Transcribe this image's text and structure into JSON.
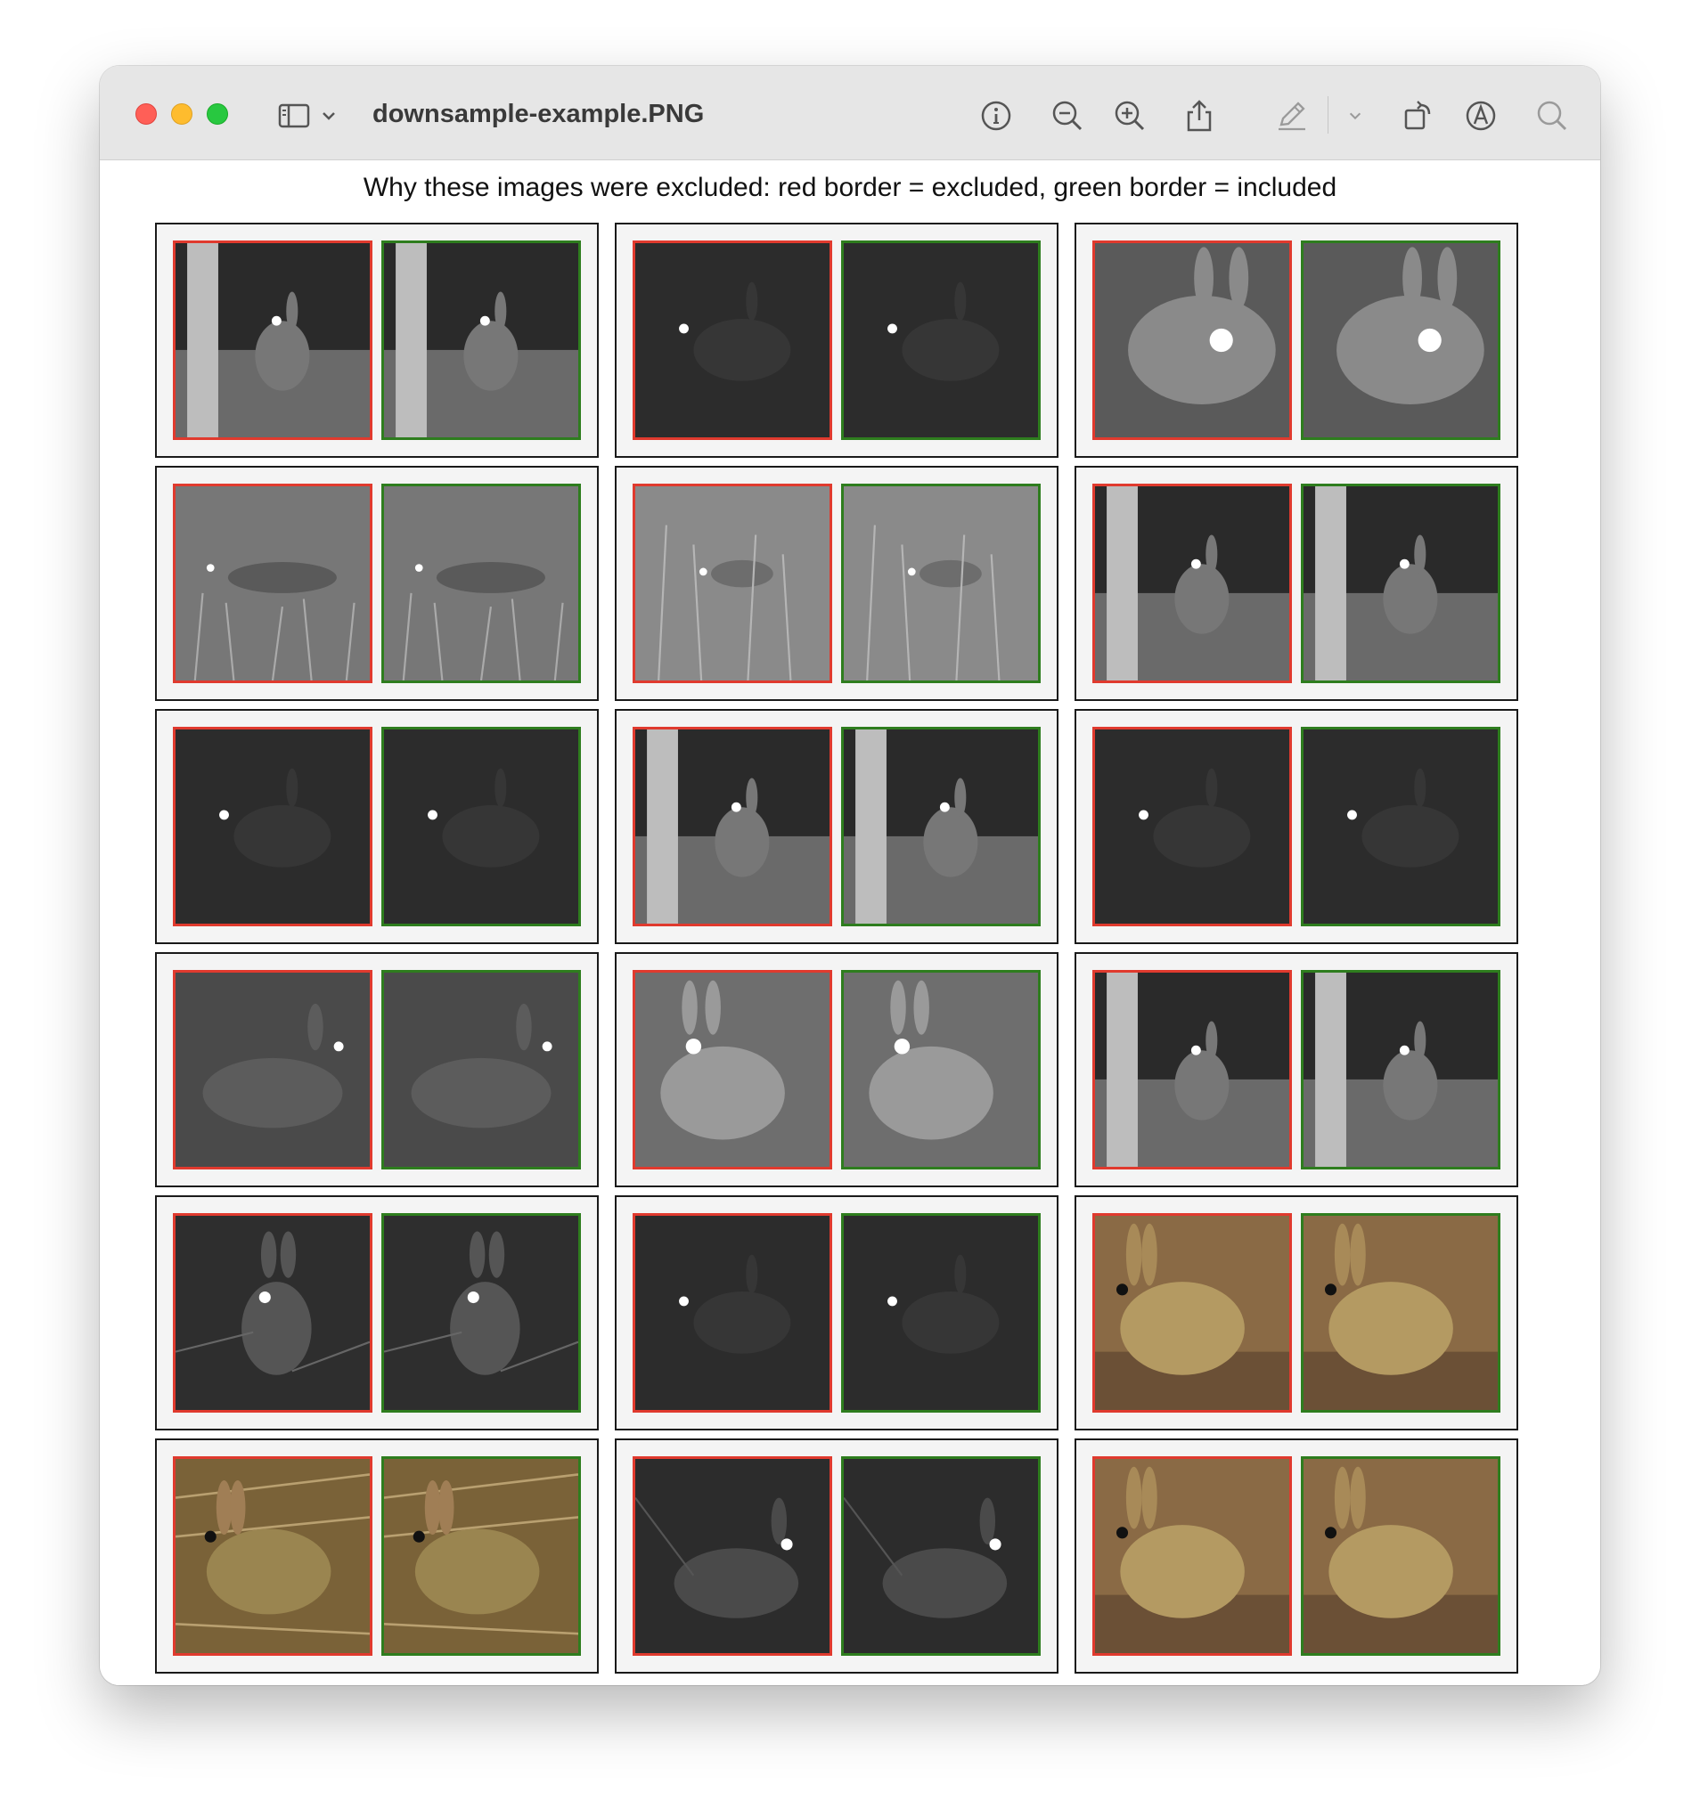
{
  "window": {
    "title": "downsample-example.PNG",
    "toolbar": [
      {
        "name": "sidebar-toggle",
        "icon": "sidebar-icon"
      },
      {
        "name": "sidebar-menu",
        "icon": "chevron-down-icon"
      },
      {
        "name": "info",
        "icon": "info-icon"
      },
      {
        "name": "zoom-out",
        "icon": "zoom-out-icon"
      },
      {
        "name": "zoom-in",
        "icon": "zoom-in-icon"
      },
      {
        "name": "share",
        "icon": "share-icon"
      },
      {
        "name": "markup",
        "icon": "pencil-icon"
      },
      {
        "name": "markup-menu",
        "icon": "chevron-down-icon"
      },
      {
        "name": "rotate",
        "icon": "rotate-icon"
      },
      {
        "name": "annotate",
        "icon": "annotate-icon"
      },
      {
        "name": "search",
        "icon": "search-icon"
      }
    ]
  },
  "heading": "Why these images were excluded: red border = excluded, green border = included",
  "legend_colors": {
    "excluded": "#e03a2e",
    "included": "#2e7d1e"
  },
  "pairs": [
    {
      "scene": "tree-night"
    },
    {
      "scene": "dark-rabbit"
    },
    {
      "scene": "close-rabbit-gray"
    },
    {
      "scene": "grass-rabbit"
    },
    {
      "scene": "grass-rabbit-light"
    },
    {
      "scene": "tree-night"
    },
    {
      "scene": "dark-rabbit"
    },
    {
      "scene": "tree-night"
    },
    {
      "scene": "dark-rabbit"
    },
    {
      "scene": "side-rabbit-dark"
    },
    {
      "scene": "bright-rabbit-gray"
    },
    {
      "scene": "tree-night"
    },
    {
      "scene": "bush-rabbit"
    },
    {
      "scene": "dark-rabbit"
    },
    {
      "scene": "color-rabbit"
    },
    {
      "scene": "color-rabbit-brush"
    },
    {
      "scene": "side-rabbit-night"
    },
    {
      "scene": "color-rabbit"
    }
  ]
}
